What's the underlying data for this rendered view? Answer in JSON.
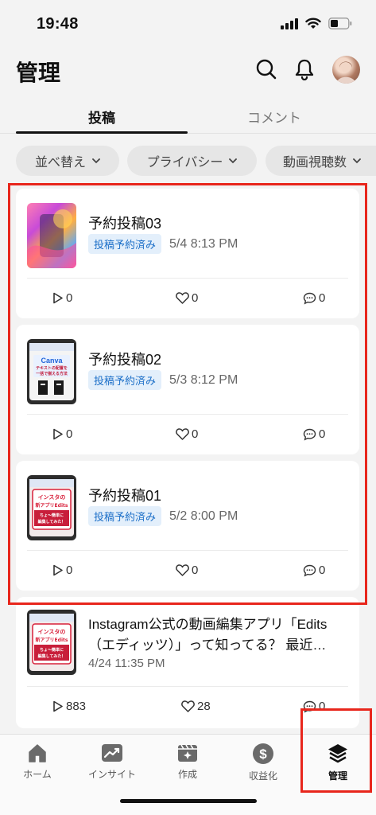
{
  "status_bar": {
    "time": "19:48"
  },
  "header": {
    "title": "管理"
  },
  "tabs": [
    {
      "label": "投稿"
    },
    {
      "label": "コメント"
    }
  ],
  "filters": [
    {
      "label": "並べ替え"
    },
    {
      "label": "プライバシー"
    },
    {
      "label": "動画視聴数"
    }
  ],
  "posts": [
    {
      "title": "予約投稿03",
      "badge": "投稿予約済み",
      "time": "5/4 8:13 PM",
      "plays": "0",
      "likes": "0",
      "comments": "0"
    },
    {
      "title": "予約投稿02",
      "badge": "投稿予約済み",
      "time": "5/3 8:12 PM",
      "plays": "0",
      "likes": "0",
      "comments": "0"
    },
    {
      "title": "予約投稿01",
      "badge": "投稿予約済み",
      "time": "5/2 8:00 PM",
      "plays": "0",
      "likes": "0",
      "comments": "0"
    },
    {
      "title_line1": "Instagram公式の動画編集アプリ「Edits",
      "title_line2": "（エディッツ）」って知ってる？ 最近…",
      "time": "4/24 11:35 PM",
      "plays": "883",
      "likes": "28",
      "comments": "0"
    }
  ],
  "thumbnails": {
    "t2": {
      "line1": "Canva",
      "line2": "テキストの配置を",
      "line3": "一括で揃える方法"
    },
    "t3": {
      "line1": "インスタの",
      "line2": "新アプリEdits",
      "line3": "ちょ～簡単に",
      "line4": "編集してみた！"
    }
  },
  "bottom_nav": [
    {
      "label": "ホーム",
      "icon": "home-icon"
    },
    {
      "label": "インサイト",
      "icon": "insights-icon"
    },
    {
      "label": "作成",
      "icon": "create-icon"
    },
    {
      "label": "収益化",
      "icon": "dollar-icon"
    },
    {
      "label": "管理",
      "icon": "layers-icon",
      "active": true
    }
  ],
  "colors": {
    "badge_text": "#1c6fc8",
    "badge_bg": "#e3effb",
    "highlight": "#e8261c"
  }
}
